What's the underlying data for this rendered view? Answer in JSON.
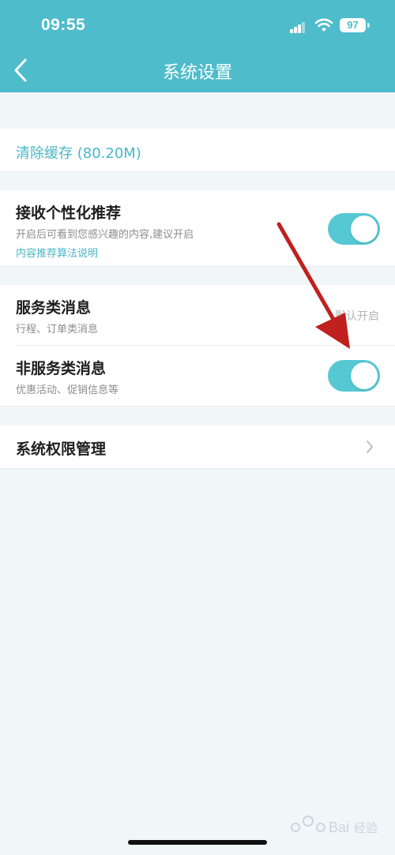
{
  "status_bar": {
    "time": "09:55",
    "battery": "97"
  },
  "nav": {
    "title": "系统设置",
    "back_icon": "chevron-left-icon"
  },
  "cache": {
    "label": "清除缓存 (80.20M)"
  },
  "personalized": {
    "title": "接收个性化推荐",
    "description": "开启后可看到您感兴趣的内容,建议开启",
    "link": "内容推荐算法说明",
    "enabled": true
  },
  "service_messages": {
    "title": "服务类消息",
    "description": "行程、订单类消息",
    "status": "默认开启"
  },
  "non_service_messages": {
    "title": "非服务类消息",
    "description": "优惠活动、促销信息等",
    "enabled": true
  },
  "permissions": {
    "title": "系统权限管理",
    "chevron_icon": "chevron-right-icon"
  },
  "watermark": {
    "text": "Bai 经验"
  },
  "colors": {
    "header": "#4fbccb",
    "accent": "#49b6c6",
    "toggle_on": "#56c8d3",
    "annotation_arrow": "#c0201e"
  }
}
